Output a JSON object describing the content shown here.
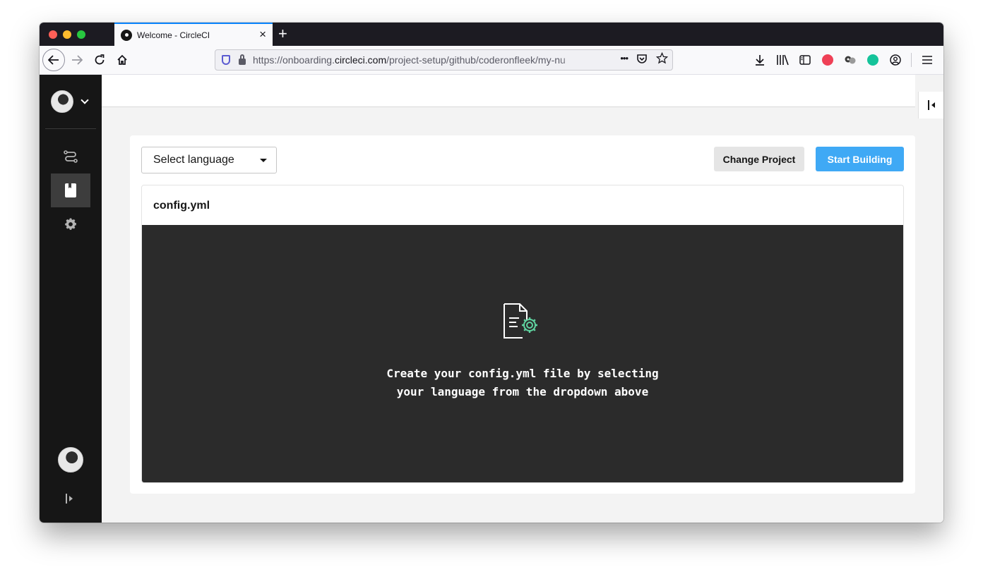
{
  "browser": {
    "tab_title": "Welcome - CircleCI",
    "tab_close": "×",
    "new_tab": "+",
    "url_prefix": "https://onboarding.",
    "url_domain": "circleci.com",
    "url_path": "/project-setup/github/coderonfleek/my-nu",
    "url_more": "•••",
    "icons": [
      "back-arrow-icon",
      "forward-arrow-icon",
      "reload-icon",
      "home-icon",
      "shield-icon",
      "lock-icon",
      "pocket-save-icon",
      "bookmark-star-icon",
      "download-icon",
      "library-icon",
      "sidebar-icon",
      "pocket-icon",
      "extension-icon",
      "grammarly-icon",
      "account-icon",
      "hamburger-menu-icon"
    ]
  },
  "sidebar": {
    "icons": [
      "avatar",
      "chevron-down-icon",
      "pipelines-icon",
      "projects-icon",
      "settings-gear-icon",
      "user-avatar",
      "expand-sidebar-icon"
    ]
  },
  "setup": {
    "language_select": "Select language",
    "change_project": "Change Project",
    "start_building": "Start Building",
    "file_name": "config.yml",
    "empty_line1": "Create your config.yml file by selecting",
    "empty_line2": "your language from the dropdown above"
  },
  "colors": {
    "sidebar_bg": "#161616",
    "primary_button": "#3fa9f5",
    "editor_bg": "#2b2b2b",
    "accent_gear": "#5fd3a0"
  }
}
